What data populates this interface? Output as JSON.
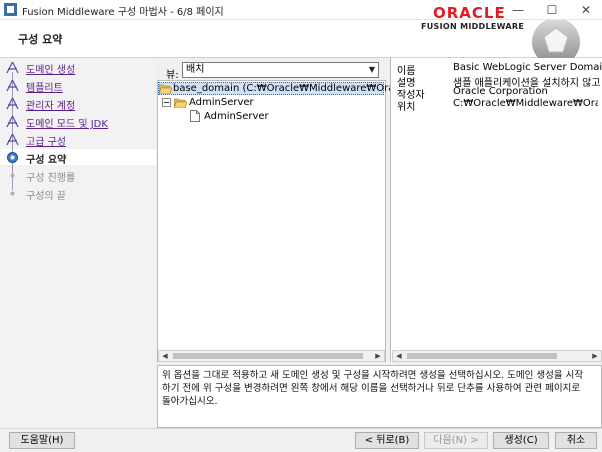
{
  "window": {
    "title": "Fusion Middleware 구성 마법사 - 6/8 페이지"
  },
  "header": {
    "heading": "구성 요약",
    "logo_oracle": "ORACLE",
    "logo_fmw": "FUSION MIDDLEWARE"
  },
  "steps": [
    {
      "label": "도메인 생성",
      "state": "done"
    },
    {
      "label": "템플리트",
      "state": "done"
    },
    {
      "label": "관리자 계정",
      "state": "done"
    },
    {
      "label": "도메인 모드 및 JDK",
      "state": "done"
    },
    {
      "label": "고급 구성",
      "state": "done"
    },
    {
      "label": "구성 요약",
      "state": "current"
    },
    {
      "label": "구성 진행률",
      "state": "pending"
    },
    {
      "label": "구성의 끝",
      "state": "pending"
    }
  ],
  "view": {
    "label": "뷰:",
    "selected": "배치"
  },
  "tree": {
    "root": "base_domain (C:₩Oracle₩Middleware₩Oracle_",
    "server": "AdminServer",
    "leaf": "AdminServer"
  },
  "properties": [
    {
      "key": "이름",
      "value": "Basic WebLogic Server Domain"
    },
    {
      "key": "설명",
      "value": "샘플 애플리케이션을 설치하지 않고"
    },
    {
      "key": "작성자",
      "value": "Oracle Corporation"
    },
    {
      "key": "위치",
      "value": "C:₩Oracle₩Middleware₩Oracle_h"
    }
  ],
  "description": {
    "line1": "위 옵션을 그대로 적용하고 새 도메인 생성 및 구성을 시작하려면 생성을 선택하십시오. 도메인 생성을 시작",
    "line2": "하기 전에 위 구성을 변경하려면 왼쪽 창에서 해당 이름을 선택하거나 뒤로 단추를 사용하여 관련 페이지로",
    "line3": "돌아가십시오."
  },
  "buttons": {
    "help": "도움말(H)",
    "back": "< 뒤로(B)",
    "next": "다음(N) >",
    "create": "생성(C)",
    "cancel": "취소"
  },
  "colors": {
    "oracle_red": "#e31b23",
    "link_purple": "#5a1f86"
  }
}
